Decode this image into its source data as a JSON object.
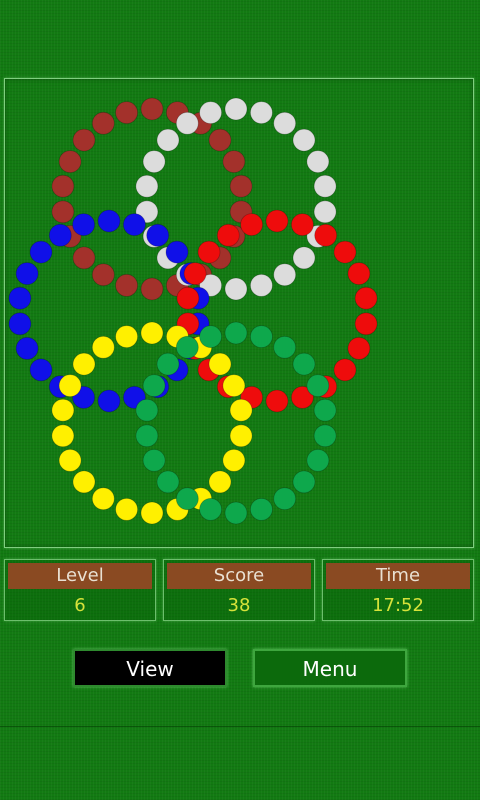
{
  "board": {
    "rings": [
      {
        "name": "red-dark",
        "color": "#a3312b",
        "balls": 22
      },
      {
        "name": "white",
        "color": "#dcdcdc",
        "balls": 22
      },
      {
        "name": "blue",
        "color": "#1010e8",
        "balls": 22
      },
      {
        "name": "red",
        "color": "#ee0c0c",
        "balls": 22
      },
      {
        "name": "yellow",
        "color": "#fff000",
        "balls": 22
      },
      {
        "name": "green",
        "color": "#0ea84c",
        "balls": 22
      }
    ]
  },
  "stats": {
    "level": {
      "label": "Level",
      "value": "6"
    },
    "score": {
      "label": "Score",
      "value": "38"
    },
    "time": {
      "label": "Time",
      "value": "17:52"
    }
  },
  "buttons": {
    "view": "View",
    "menu": "Menu"
  }
}
